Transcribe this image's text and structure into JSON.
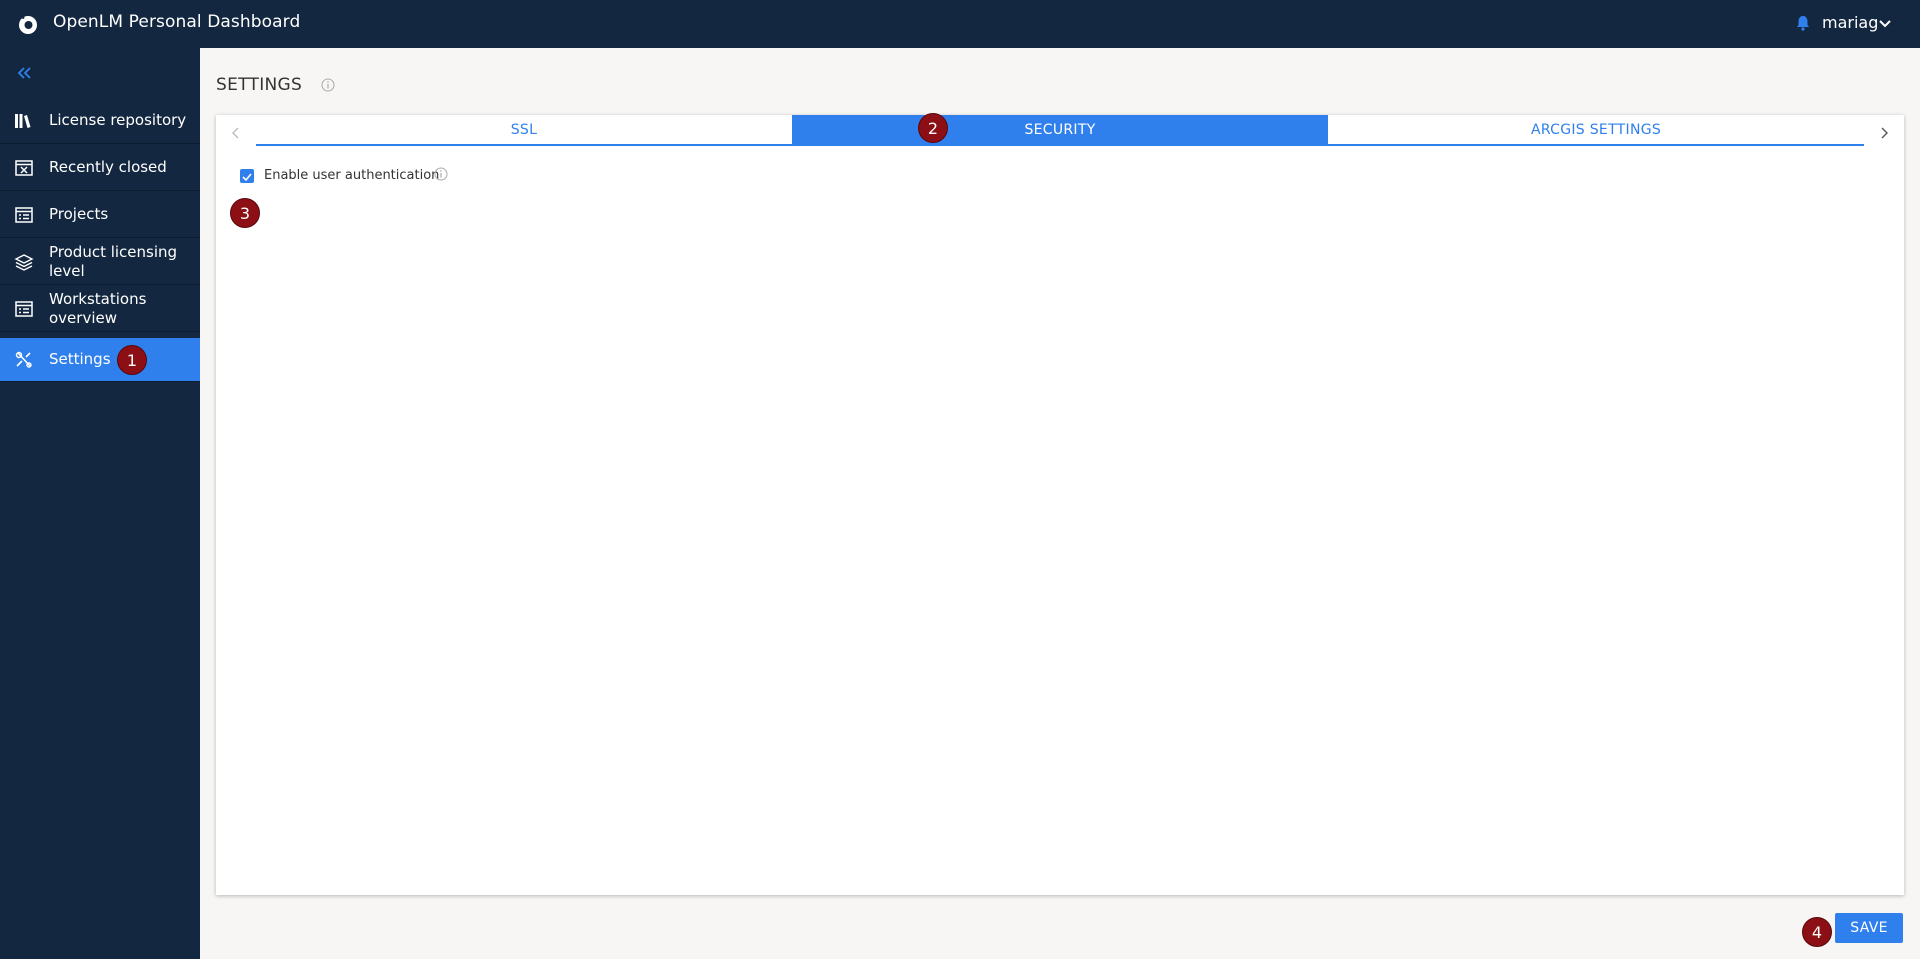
{
  "header": {
    "title": "OpenLM Personal Dashboard",
    "username": "mariag",
    "icons": [
      "openlm-logo-icon",
      "bell-icon",
      "chevron-down-icon"
    ]
  },
  "sidebar": {
    "collapse_icon": "double-chevron-left-icon",
    "items": [
      {
        "label": "License repository",
        "icon": "books-icon"
      },
      {
        "label": "Recently closed",
        "icon": "closed-window-icon"
      },
      {
        "label": "Projects",
        "icon": "list-icon"
      },
      {
        "label": "Product licensing level",
        "icon": "layers-icon"
      },
      {
        "label": "Workstations overview",
        "icon": "list-icon"
      },
      {
        "label": "Settings",
        "icon": "tools-icon",
        "active": true
      }
    ]
  },
  "main": {
    "title": "SETTINGS",
    "tabs": [
      {
        "label": "SSL",
        "active": false
      },
      {
        "label": "SECURITY",
        "active": true
      },
      {
        "label": "ARCGIS SETTINGS",
        "active": false
      }
    ],
    "security": {
      "enable_user_auth_label": "Enable user authentication",
      "enable_user_auth_checked": true
    },
    "save_label": "SAVE"
  },
  "annotations": [
    "1",
    "2",
    "3",
    "4"
  ],
  "colors": {
    "navy": "#132840",
    "accent": "#2f80ed",
    "badge": "#8b0f14",
    "background": "#f7f6f4"
  }
}
